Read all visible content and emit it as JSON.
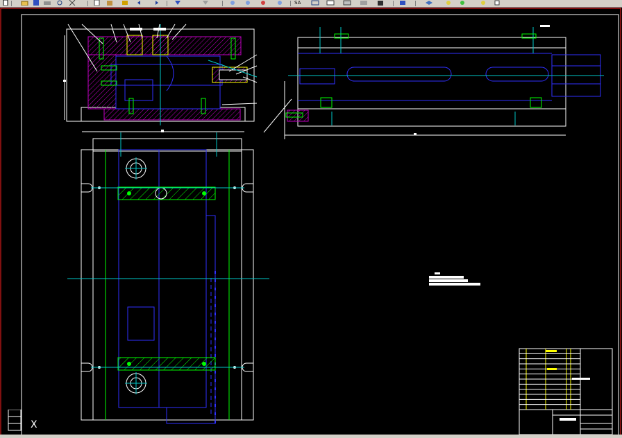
{
  "colors": {
    "background": "#000000",
    "frame": "#ff2020",
    "white": "#ffffff",
    "green": "#00ff00",
    "cyan": "#00c8c8",
    "blue": "#3030ff",
    "magenta": "#c000c0",
    "yellow": "#ffff00",
    "toolbar": "#d4d0c8"
  },
  "toolbar": {
    "buttons": [
      "new-icon",
      "open-icon",
      "save-icon",
      "print-icon",
      "preview-icon",
      "cut-icon",
      "copy-icon",
      "paste-icon",
      "match-icon",
      "undo-icon",
      "redo-icon",
      "pan-icon",
      "zoom-realtime-icon",
      "zoom-window-icon",
      "zoom-previous-icon",
      "properties-icon",
      "design-center-icon",
      "tool-palettes-icon",
      "sheet-set-icon",
      "markup-icon",
      "calculator-icon",
      "text-style-icon",
      "dim-style-icon",
      "table-style-icon",
      "layer-icon"
    ],
    "text_style_label": "SA"
  },
  "drawing": {
    "ucs_label": "X",
    "title_block_rows": 12
  }
}
